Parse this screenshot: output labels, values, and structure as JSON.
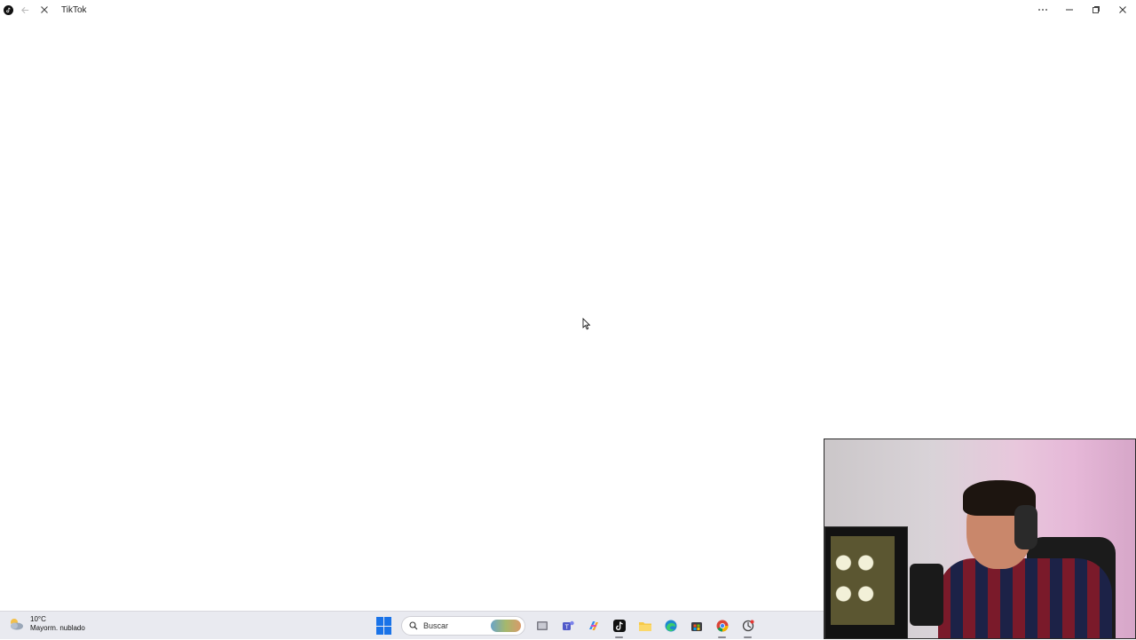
{
  "window": {
    "title": "TikTok",
    "controls": [
      "more-options",
      "minimize",
      "restore",
      "close"
    ]
  },
  "taskbar": {
    "weather": {
      "temp": "10°C",
      "desc": "Mayorm. nublado"
    },
    "search": {
      "placeholder": "Buscar"
    },
    "apps": [
      "start-icon",
      "task-view-icon",
      "teams-icon",
      "copilot-icon",
      "tiktok-icon",
      "file-explorer-icon",
      "edge-icon",
      "store-icon",
      "chrome-icon",
      "app-icon"
    ]
  },
  "colors": {
    "taskbar_bg": "#e9eaf0",
    "accent": "#1a73e8",
    "page_bg": "#ffffff"
  }
}
